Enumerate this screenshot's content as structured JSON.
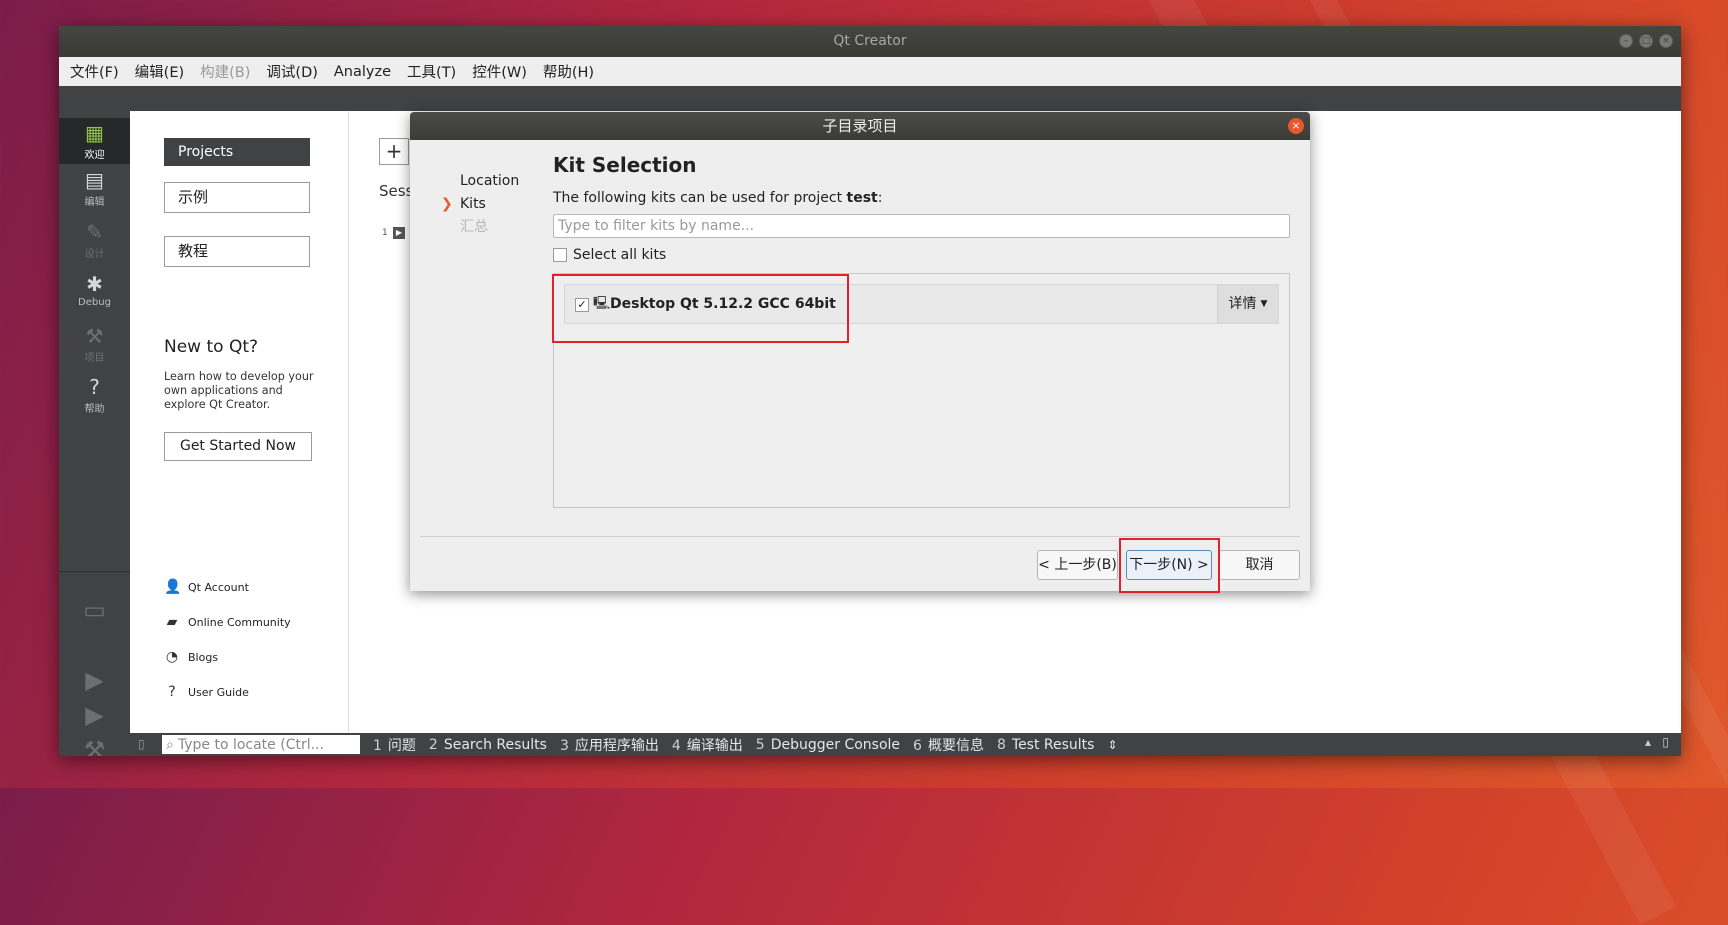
{
  "window": {
    "title": "Qt Creator",
    "controls": [
      "–",
      "□",
      "×"
    ]
  },
  "menubar": {
    "items": [
      {
        "label": "文件(F)",
        "disabled": false
      },
      {
        "label": "编辑(E)",
        "disabled": false
      },
      {
        "label": "构建(B)",
        "disabled": true
      },
      {
        "label": "调试(D)",
        "disabled": false
      },
      {
        "label": "Analyze",
        "disabled": false
      },
      {
        "label": "工具(T)",
        "disabled": false
      },
      {
        "label": "控件(W)",
        "disabled": false
      },
      {
        "label": "帮助(H)",
        "disabled": false
      }
    ]
  },
  "modebar": {
    "modes": [
      {
        "label": "欢迎",
        "icon": "grid-icon"
      },
      {
        "label": "编辑",
        "icon": "edit-document-icon"
      },
      {
        "label": "设计",
        "icon": "pencil-icon"
      },
      {
        "label": "Debug",
        "icon": "bug-icon"
      },
      {
        "label": "项目",
        "icon": "wrench-icon"
      },
      {
        "label": "帮助",
        "icon": "help-icon"
      }
    ]
  },
  "welcome": {
    "nav": [
      "Projects",
      "示例",
      "教程"
    ],
    "new_title": "New to Qt?",
    "new_desc": "Learn how to develop your own applications and explore Qt Creator.",
    "get_started": "Get Started Now",
    "links": [
      "Qt Account",
      "Online Community",
      "Blogs",
      "User Guide"
    ],
    "bg_plus": "+",
    "bg_sessions": "Sess",
    "bg_session_num": "1"
  },
  "outputbar": {
    "locator_placeholder": "Type to locate (Ctrl...",
    "tabs": [
      {
        "num": "1",
        "label": "问题"
      },
      {
        "num": "2",
        "label": "Search Results"
      },
      {
        "num": "3",
        "label": "应用程序输出"
      },
      {
        "num": "4",
        "label": "编译输出"
      },
      {
        "num": "5",
        "label": "Debugger Console"
      },
      {
        "num": "6",
        "label": "概要信息"
      },
      {
        "num": "8",
        "label": "Test Results"
      }
    ],
    "more": "⇕"
  },
  "dialog": {
    "title": "子目录项目",
    "steps": [
      {
        "label": "Location",
        "state": "done"
      },
      {
        "label": "Kits",
        "state": "current"
      },
      {
        "label": "汇总",
        "state": "inactive"
      }
    ],
    "heading": "Kit Selection",
    "desc_prefix": "The following kits can be used for project ",
    "project_name": "test",
    "desc_suffix": ":",
    "filter_placeholder": "Type to filter kits by name...",
    "select_all_label": "Select all kits",
    "kits": [
      {
        "name": "Desktop Qt 5.12.2 GCC 64bit",
        "checked": true,
        "details": "详情"
      }
    ],
    "buttons": {
      "back": "< 上一步(B)",
      "next": "下一步(N) >",
      "cancel": "取消"
    }
  },
  "colors": {
    "accent_orange": "#e7582c",
    "highlight_red": "#e3202b",
    "sidebar_dark": "#404244",
    "welcome_active": "#8fc34a"
  }
}
